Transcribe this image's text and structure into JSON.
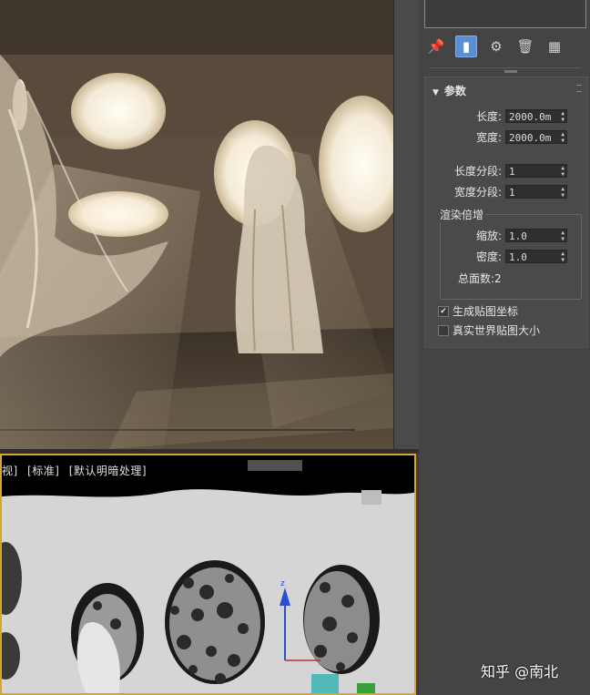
{
  "viewport_bottom": {
    "labels": [
      "视]",
      "[标准]",
      "[默认明暗处理]"
    ]
  },
  "toolbar": {
    "icons": [
      "pin-icon",
      "modifier-stack-icon",
      "show-end-result-icon",
      "delete-icon",
      "configure-icon"
    ]
  },
  "params": {
    "title": "参数",
    "length_label": "长度:",
    "length_value": "2000.0m",
    "width_label": "宽度:",
    "width_value": "2000.0m",
    "length_segs_label": "长度分段:",
    "length_segs_value": "1",
    "width_segs_label": "宽度分段:",
    "width_segs_value": "1",
    "render_group_label": "渲染倍增",
    "scale_label": "缩放:",
    "scale_value": "1.0",
    "density_label": "密度:",
    "density_value": "1.0",
    "total_faces_label": "总面数:2",
    "gen_mapping_label": "生成贴图坐标",
    "gen_mapping_checked": true,
    "real_world_label": "真实世界贴图大小",
    "real_world_checked": false
  },
  "watermark": "知乎 @南北"
}
